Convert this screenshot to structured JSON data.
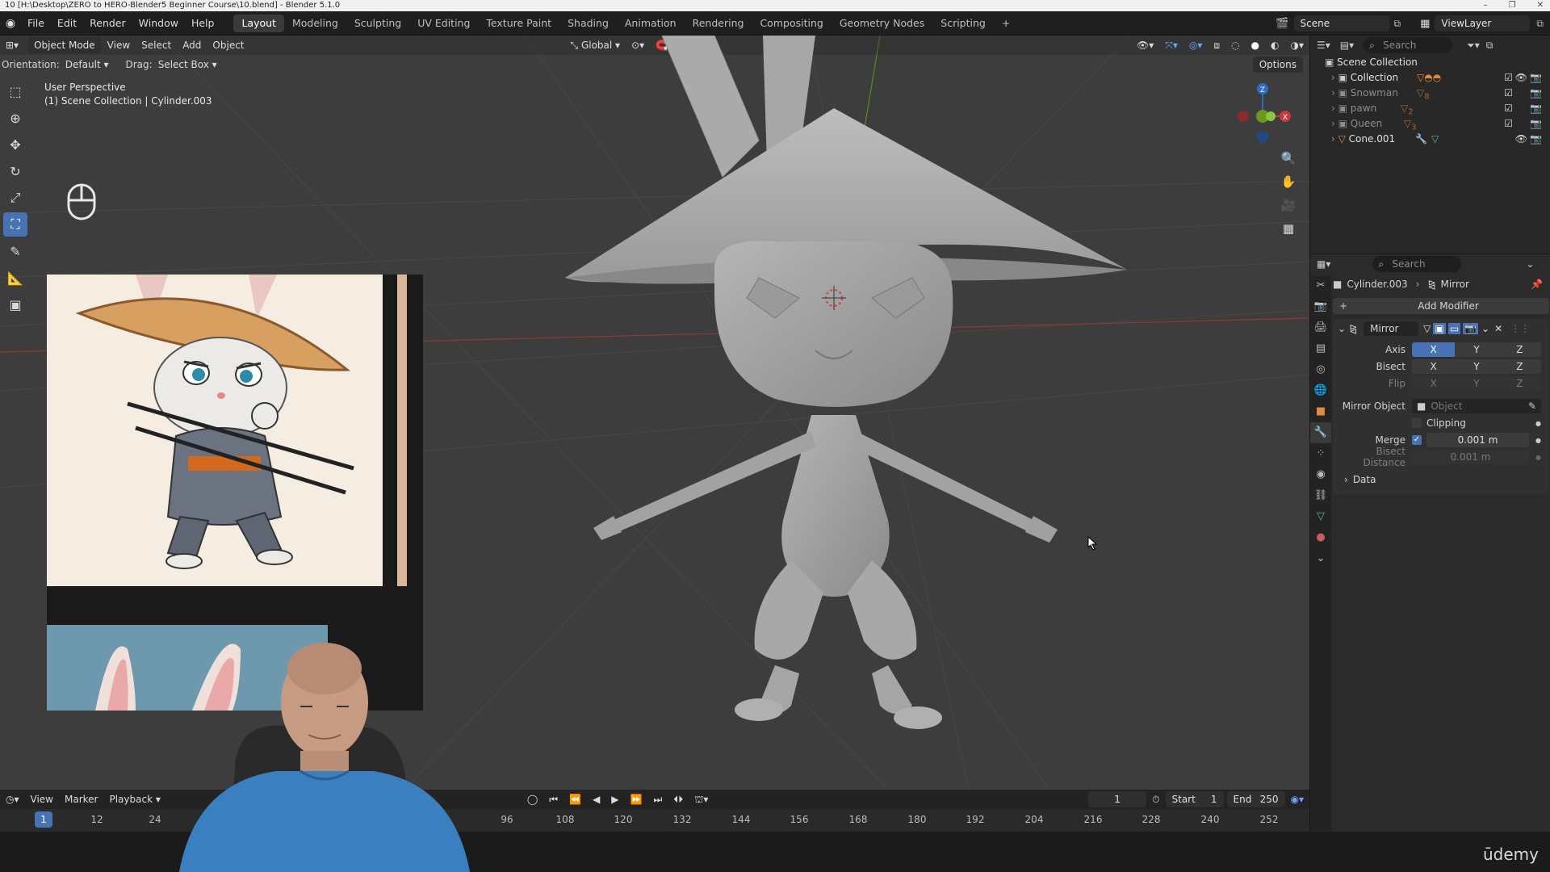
{
  "window": {
    "title": "10 [H:\\Desktop\\ZERO to HERO-Blender5 Beginner Course\\10.blend] - Blender 5.1.0",
    "controls": [
      "–",
      "❐",
      "✕"
    ]
  },
  "topbar": {
    "menus": [
      "File",
      "Edit",
      "Render",
      "Window",
      "Help"
    ],
    "workspaces": [
      "Layout",
      "Modeling",
      "Sculpting",
      "UV Editing",
      "Texture Paint",
      "Shading",
      "Animation",
      "Rendering",
      "Compositing",
      "Geometry Nodes",
      "Scripting",
      "+"
    ],
    "active_workspace": "Layout",
    "scene": "Scene",
    "view_layer": "ViewLayer"
  },
  "viewport": {
    "mode": "Object Mode",
    "menus": [
      "View",
      "Select",
      "Add",
      "Object"
    ],
    "transform_orientation": "Global",
    "orientation_label": "Orientation:",
    "orientation_value": "Default",
    "drag_label": "Drag:",
    "drag_value": "Select Box",
    "options_label": "Options",
    "perspective": "User Perspective",
    "collection_info": "(1) Scene Collection | Cylinder.003",
    "gizmo_axes": {
      "x": "X",
      "y": "Y",
      "z": "Z"
    }
  },
  "timeline": {
    "menus": [
      "View",
      "Marker",
      "Playback"
    ],
    "current_frame": "1",
    "start_label": "Start",
    "start": "1",
    "end_label": "End",
    "end": "250",
    "ticks": [
      "1",
      "12",
      "24",
      "96",
      "108",
      "120",
      "132",
      "144",
      "156",
      "168",
      "180",
      "192",
      "204",
      "216",
      "228",
      "240",
      "252"
    ]
  },
  "outliner": {
    "search_placeholder": "Search",
    "root": "Scene Collection",
    "items": [
      {
        "name": "Collection",
        "badge": "",
        "dim": false
      },
      {
        "name": "Snowman",
        "badge": "8",
        "dim": true
      },
      {
        "name": "pawn",
        "badge": "2",
        "dim": true
      },
      {
        "name": "Queen",
        "badge": "3",
        "dim": true
      },
      {
        "name": "Cone.001",
        "badge": "",
        "dim": false
      }
    ]
  },
  "properties": {
    "search_placeholder": "Search",
    "object": "Cylinder.003",
    "modifier_crumb": "Mirror",
    "add_modifier": "Add Modifier",
    "modifier_name": "Mirror",
    "axis_label": "Axis",
    "bisect_label": "Bisect",
    "flip_label": "Flip",
    "x": "X",
    "y": "Y",
    "z": "Z",
    "mirror_object_label": "Mirror Object",
    "mirror_object_placeholder": "Object",
    "clipping_label": "Clipping",
    "merge_label": "Merge",
    "merge_value": "0.001 m",
    "bisect_distance_label": "Bisect Distance",
    "bisect_distance_value": "0.001 m",
    "data_label": "Data"
  },
  "watermark": "ūdemy",
  "colors": {
    "accent": "#4772b3",
    "viewport_bg": "#3d3d3d",
    "panel_bg": "#2b2b2b"
  }
}
